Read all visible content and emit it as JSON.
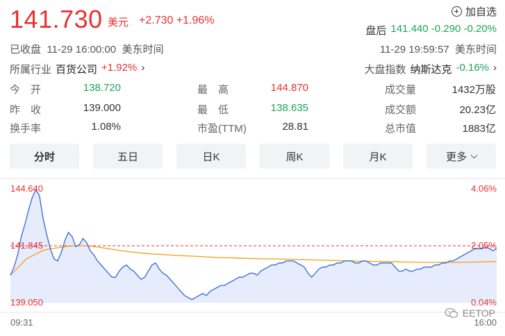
{
  "quote": {
    "price": "141.730",
    "currency": "美元",
    "change": "+2.730 +1.96%"
  },
  "watch": {
    "label": "加自选",
    "icon": "add-circle-icon"
  },
  "after_hours": {
    "label": "盘后",
    "value": "141.440 -0.290 -0.20%"
  },
  "status": {
    "closed": "已收盘  11-29 16:00:00  美东时间",
    "after_time": "11-29 19:59:57  美东时间"
  },
  "industry": {
    "label": "所属行业",
    "name": "百货公司",
    "change": "+1.92%",
    "chevron": "›"
  },
  "market": {
    "label": "大盘指数",
    "name": "纳斯达克",
    "change": "-0.16%",
    "chevron": "›"
  },
  "stats": [
    {
      "label": "今　开",
      "value": "138.720",
      "color": "#1aa45c"
    },
    {
      "label": "最　高",
      "value": "144.870",
      "color": "#e93030"
    },
    {
      "label": "成交量",
      "value": "1432万股",
      "color": "#333333"
    },
    {
      "label": "昨　收",
      "value": "139.000",
      "color": "#333333"
    },
    {
      "label": "最　低",
      "value": "138.635",
      "color": "#1aa45c"
    },
    {
      "label": "成交额",
      "value": "20.23亿",
      "color": "#333333"
    },
    {
      "label": "换手率",
      "value": "1.08%",
      "color": "#333333"
    },
    {
      "label": "市盈(TTM)",
      "value": "28.81",
      "color": "#333333"
    },
    {
      "label": "总市值",
      "value": "1883亿",
      "color": "#333333"
    }
  ],
  "tabs": [
    "分时",
    "五日",
    "日K",
    "周K",
    "月K",
    "更多"
  ],
  "watermark": "EETOP",
  "chart_data": {
    "type": "line",
    "title": "",
    "y_labels_left": [
      "144.640",
      "141.845",
      "139.050"
    ],
    "y_labels_right": [
      "4.06%",
      "2.05%",
      "0.04%"
    ],
    "x_labels": [
      "09:31",
      "16:00"
    ],
    "ylim": [
      139.05,
      144.64
    ],
    "reference_price": 141.845,
    "colors": {
      "price": "#3366dd",
      "average": "#f5a623",
      "reference": "#e93030",
      "fill": "#e6ecfb"
    },
    "series": [
      {
        "values": [
          140.4,
          140.8,
          141.4,
          142.3,
          142.9,
          143.6,
          144.2,
          144.6,
          144.3,
          143.2,
          142.4,
          141.7,
          141.2,
          141.1,
          141.5,
          142.1,
          142.5,
          142.3,
          141.8,
          141.9,
          142.2,
          142.0,
          141.6,
          141.4,
          141.1,
          140.9,
          140.7,
          140.5,
          140.3,
          140.3,
          140.6,
          140.8,
          140.9,
          140.7,
          140.6,
          140.4,
          140.2,
          140.3,
          140.6,
          140.9,
          141.0,
          140.7,
          140.5,
          140.4,
          140.2,
          140.0,
          139.8,
          139.6,
          139.4,
          139.3,
          139.2,
          139.3,
          139.4,
          139.5,
          139.4,
          139.6,
          139.7,
          139.8,
          139.9,
          139.9,
          140.0,
          140.1,
          140.2,
          140.3,
          140.3,
          140.4,
          140.5,
          140.5,
          140.4,
          140.6,
          140.7,
          140.8,
          140.9,
          140.9,
          141.0,
          141.0,
          141.1,
          141.1,
          141.1,
          141.0,
          140.9,
          140.8,
          140.5,
          140.3,
          140.5,
          140.7,
          140.8,
          140.8,
          140.9,
          140.9,
          141.0,
          141.0,
          141.1,
          141.1,
          141.1,
          141.0,
          141.0,
          141.1,
          141.1,
          141.0,
          140.9,
          140.9,
          141.0,
          141.0,
          141.0,
          141.0,
          140.8,
          140.6,
          140.6,
          140.7,
          140.6,
          140.6,
          140.7,
          140.7,
          140.8,
          140.8,
          140.8,
          140.9,
          140.9,
          141.0,
          141.0,
          141.1,
          141.1,
          141.2,
          141.3,
          141.4,
          141.5,
          141.6,
          141.7,
          141.7,
          141.7,
          141.8,
          141.7,
          141.6,
          141.7
        ]
      },
      {
        "values": [
          140.4,
          140.8,
          141.2,
          141.4,
          141.6,
          141.7,
          141.75,
          141.8,
          141.85,
          141.85,
          141.82,
          141.78,
          141.72,
          141.66,
          141.6,
          141.55,
          141.5,
          141.47,
          141.44,
          141.42,
          141.39,
          141.37,
          141.35,
          141.33,
          141.31,
          141.29,
          141.27,
          141.26,
          141.25,
          141.23,
          141.22,
          141.21,
          141.2,
          141.2,
          141.19,
          141.18,
          141.17,
          141.16,
          141.15,
          141.14,
          141.13,
          141.12,
          141.11,
          141.1,
          141.09,
          141.08,
          141.07,
          141.07,
          141.06,
          141.05,
          141.04,
          141.04,
          141.03,
          141.03,
          141.03,
          141.03,
          141.03,
          141.04,
          141.04,
          141.05,
          141.06,
          141.07
        ]
      }
    ]
  }
}
